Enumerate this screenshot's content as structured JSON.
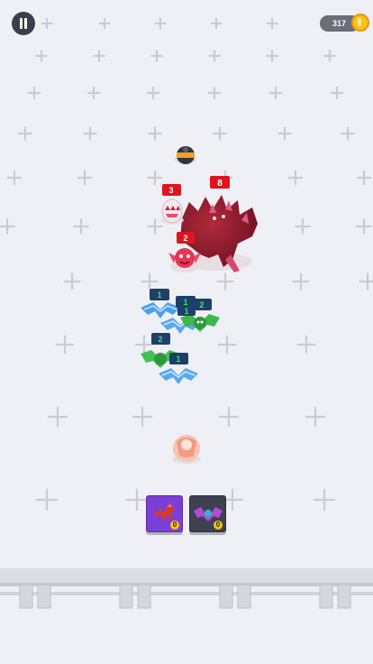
{
  "hud": {
    "coins": "317",
    "pause_icon": "pause-icon",
    "coin_icon": "gold-coin-icon"
  },
  "enemies": {
    "boss_level": "8",
    "egg_level": "3",
    "imp_level": "2"
  },
  "allies": {
    "blue_bat_a_level": "1",
    "blue_bat_b_level": "1",
    "green_bat_a_level": "2",
    "green_bat_b_level": "1",
    "green_bat_c_level": "2",
    "blue_bat_c_level": "1"
  },
  "cards": [
    {
      "name": "red-dragon-card",
      "count": "0",
      "color": "#7c3fd6"
    },
    {
      "name": "purple-bat-card",
      "count": "0",
      "color": "#3e4150"
    }
  ],
  "colors": {
    "background": "#eef0f6",
    "enemy_badge": "#e0141e",
    "ally_badge": "#1e3f6a",
    "ally_level_text": "#3fe35a"
  }
}
